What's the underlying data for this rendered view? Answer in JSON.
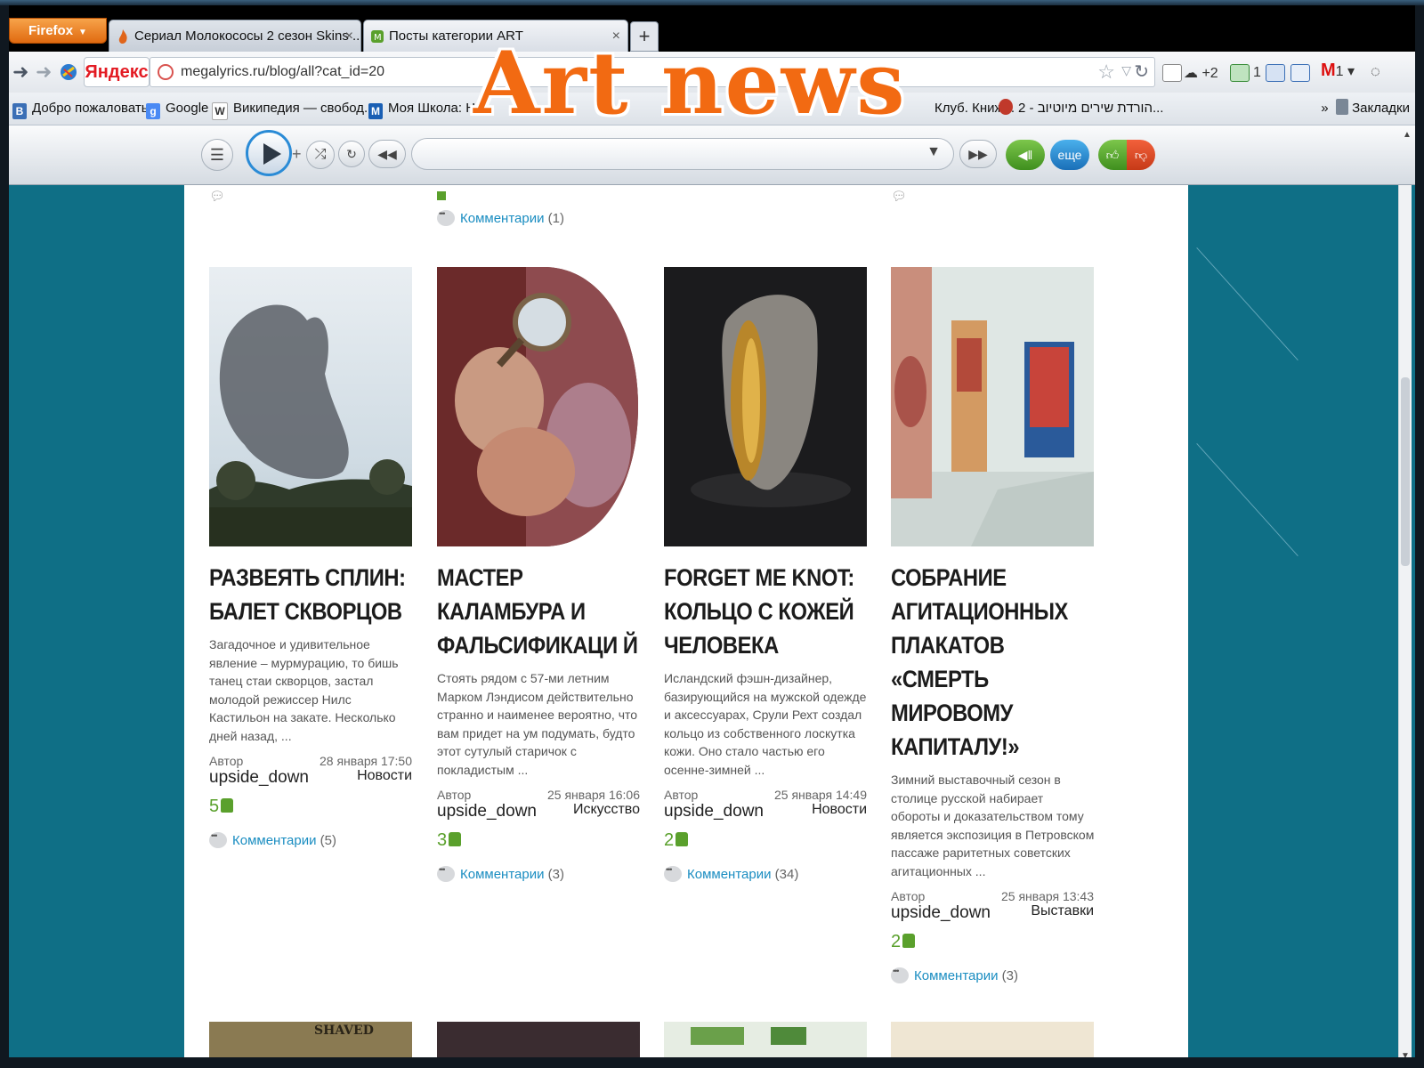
{
  "overlay_title": "Art news",
  "browser": {
    "menu_button": "Firefox",
    "tabs": [
      {
        "label": "Сериал Молокососы 2 сезон Skins ...",
        "active": false
      },
      {
        "label": "Посты категории ART",
        "active": true
      }
    ],
    "new_tab": "+",
    "search_engine": "Яндекс",
    "url": "megalyrics.ru/blog/all?cat_id=20",
    "tray": {
      "cloud_count": "+2",
      "sync_count": "1",
      "mail_count": "1"
    },
    "bookmarks": [
      {
        "label": "Добро пожаловать",
        "icon": "В",
        "color": "#3b6fb6"
      },
      {
        "label": "Google",
        "icon": "g",
        "color": "#4a8af4"
      },
      {
        "label": "Википедия — свобод...",
        "icon": "W",
        "color": "#666666"
      },
      {
        "label": "Моя Школа: Н",
        "icon": "M",
        "color": "#1a5fb4"
      },
      {
        "label": "Клуб. Книж...",
        "icon": "",
        "color": "#888888"
      },
      {
        "label": "2 - הורדת שירים מיוטיוב...",
        "icon": "",
        "color": "#c0392b"
      }
    ],
    "bookmarks_overflow": "»",
    "bookmarks_menu": "Закладки"
  },
  "player": {
    "more_label": "еще"
  },
  "top_stub_comments": {
    "label": "Комментарии",
    "count": "(1)"
  },
  "posts": [
    {
      "title": "РАЗВЕЯТЬ СПЛИН: БАЛЕТ СКВОРЦОВ",
      "excerpt": "Загадочное и удивительное явление – мурмурацию, то бишь танец стаи скворцов, застал молодой режиссер Нилс Кастильон на закате. Несколько дней назад, ...",
      "author_label": "Автор",
      "author": "upside_down",
      "date": "28 января 17:50",
      "category": "Новости",
      "likes": "5",
      "comments_label": "Комментарии",
      "comments_count": "(5)"
    },
    {
      "title": "МАСТЕР КАЛАМБУРА И ФАЛЬСИФИКАЦИ Й",
      "excerpt": "Стоять рядом с 57-ми летним Марком Лэндисом действительно странно и наименее вероятно, что вам придет на ум подумать, будто этот сутулый старичок с покладистым ...",
      "author_label": "Автор",
      "author": "upside_down",
      "date": "25 января 16:06",
      "category": "Искусство",
      "likes": "3",
      "comments_label": "Комментарии",
      "comments_count": "(3)"
    },
    {
      "title": "FORGET ME KNOT: КОЛЬЦО С КОЖЕЙ ЧЕЛОВЕКА",
      "excerpt": "Исландский фэшн-дизайнер, базирующийся на мужской одежде и аксессуарах, Срули Рехт создал кольцо из собственного лоскутка кожи. Оно стало частью его осенне-зимней ...",
      "author_label": "Автор",
      "author": "upside_down",
      "date": "25 января 14:49",
      "category": "Новости",
      "likes": "2",
      "comments_label": "Комментарии",
      "comments_count": "(34)"
    },
    {
      "title": "СОБРАНИЕ АГИТАЦИОННЫХ ПЛАКАТОВ «СМЕРТЬ МИРОВОМУ КАПИТАЛУ!»",
      "excerpt": "Зимний выставочный сезон в столице русской набирает обороты и доказательством тому является экспозиция в Петровском пассаже раритетных советских агитационных ...",
      "author_label": "Автор",
      "author": "upside_down",
      "date": "25 января 13:43",
      "category": "Выставки",
      "likes": "2",
      "comments_label": "Комментарии",
      "comments_count": "(3)"
    }
  ],
  "bottom_thumb_text": "SHAVED",
  "colors": {
    "accent_orange": "#f26a12",
    "page_bg": "#0f6f86",
    "link": "#1a8dc1",
    "like_green": "#5aa02c"
  }
}
